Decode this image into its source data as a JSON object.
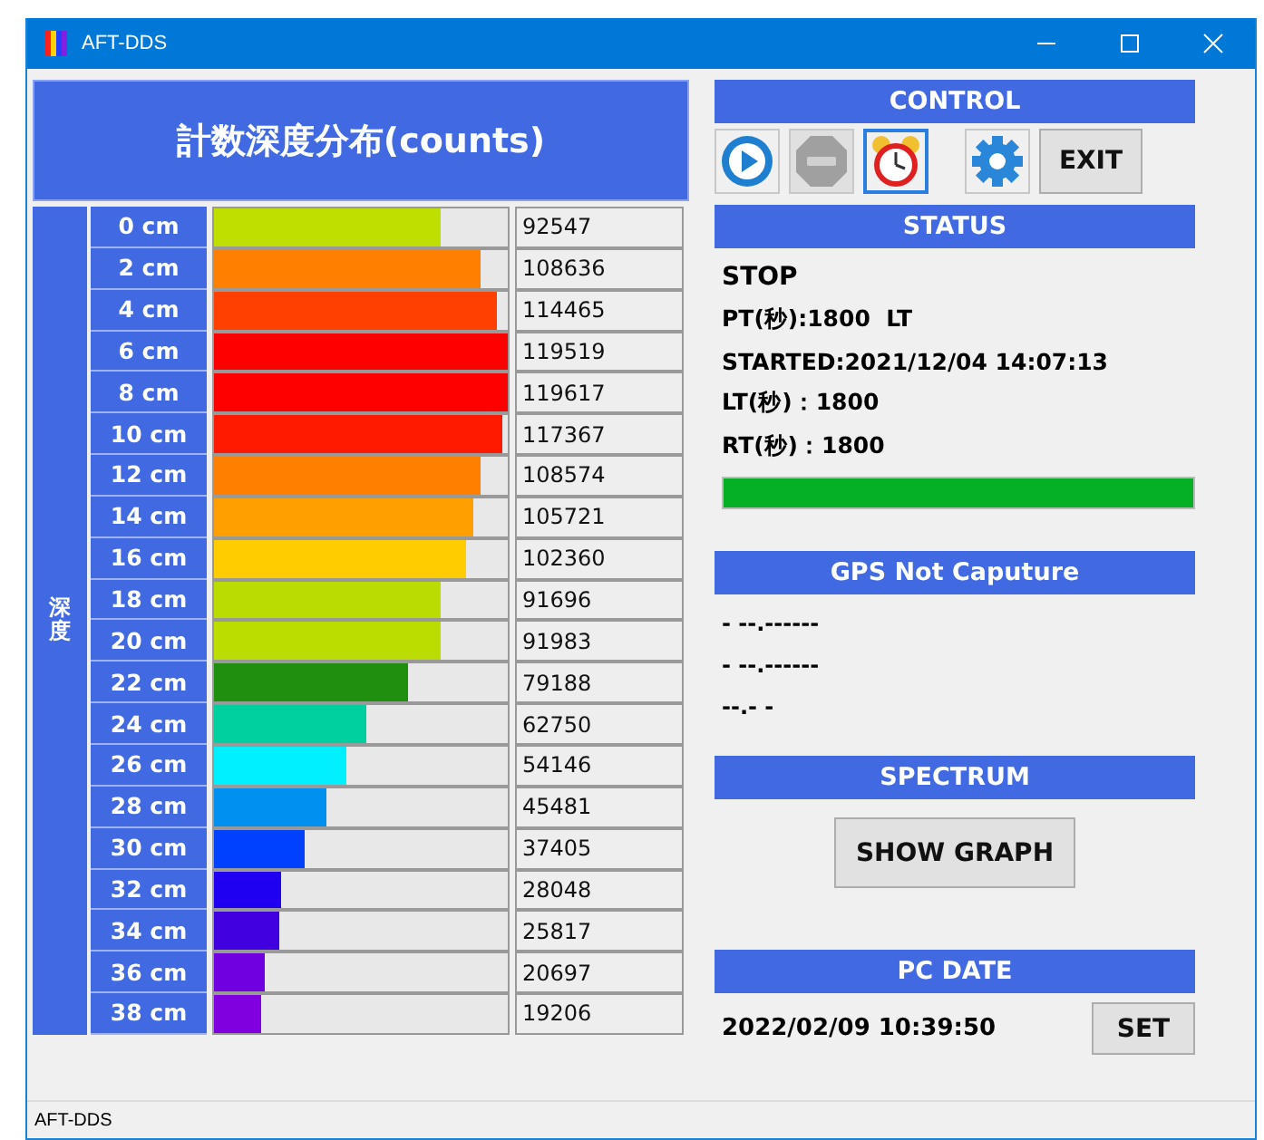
{
  "window": {
    "title": "AFT-DDS"
  },
  "chart_panel": {
    "title": "計数深度分布(counts)",
    "axis_label": "深度",
    "rows": [
      {
        "depth": "0 cm",
        "level": 0.77,
        "color": "#bfdf00",
        "count": "92547"
      },
      {
        "depth": "2 cm",
        "level": 0.91,
        "color": "#ff8000",
        "count": "108636"
      },
      {
        "depth": "4 cm",
        "level": 0.96,
        "color": "#ff4000",
        "count": "114465"
      },
      {
        "depth": "6 cm",
        "level": 1.0,
        "color": "#ff0000",
        "count": "119519"
      },
      {
        "depth": "8 cm",
        "level": 1.0,
        "color": "#ff0000",
        "count": "119617"
      },
      {
        "depth": "10 cm",
        "level": 0.98,
        "color": "#ff1a00",
        "count": "117367"
      },
      {
        "depth": "12 cm",
        "level": 0.91,
        "color": "#ff7f00",
        "count": "108574"
      },
      {
        "depth": "14 cm",
        "level": 0.88,
        "color": "#ffa000",
        "count": "105721"
      },
      {
        "depth": "16 cm",
        "level": 0.86,
        "color": "#ffcc00",
        "count": "102360"
      },
      {
        "depth": "18 cm",
        "level": 0.77,
        "color": "#bbdc00",
        "count": "91696"
      },
      {
        "depth": "20 cm",
        "level": 0.77,
        "color": "#bbdd00",
        "count": "91983"
      },
      {
        "depth": "22 cm",
        "level": 0.66,
        "color": "#208f10",
        "count": "79188"
      },
      {
        "depth": "24 cm",
        "level": 0.52,
        "color": "#00d0a0",
        "count": "62750"
      },
      {
        "depth": "26 cm",
        "level": 0.45,
        "color": "#00f0ff",
        "count": "54146"
      },
      {
        "depth": "28 cm",
        "level": 0.38,
        "color": "#0090f0",
        "count": "45481"
      },
      {
        "depth": "30 cm",
        "level": 0.31,
        "color": "#0040ff",
        "count": "37405"
      },
      {
        "depth": "32 cm",
        "level": 0.23,
        "color": "#2000f0",
        "count": "28048"
      },
      {
        "depth": "34 cm",
        "level": 0.22,
        "color": "#4000e0",
        "count": "25817"
      },
      {
        "depth": "36 cm",
        "level": 0.17,
        "color": "#7000e0",
        "count": "20697"
      },
      {
        "depth": "38 cm",
        "level": 0.16,
        "color": "#8000e0",
        "count": "19206"
      }
    ]
  },
  "control": {
    "title": "CONTROL",
    "tools": [
      {
        "kind": "play",
        "disabled": false,
        "focused": false
      },
      {
        "kind": "stop",
        "disabled": true,
        "focused": false
      },
      {
        "kind": "alarm",
        "disabled": false,
        "focused": true
      },
      {
        "kind": "settings",
        "disabled": false,
        "focused": false
      }
    ],
    "exit_button": "EXIT"
  },
  "status": {
    "title": "STATUS",
    "state": "STOP",
    "lines": [
      "PT(秒):1800  LT",
      "STARTED:2021/12/04 14:07:13",
      "LT(秒)：1800",
      "RT(秒)：1800"
    ],
    "level": 1.0
  },
  "gps": {
    "title": "GPS Not Caputure",
    "lines": [
      "- --.------",
      "- --.------",
      "--.- -"
    ]
  },
  "spectrum": {
    "title": "SPECTRUM",
    "button": "SHOW GRAPH"
  },
  "pc_date": {
    "title": "PC DATE",
    "value": "2022/02/09 10:39:50",
    "button": "SET"
  },
  "status_bar": "AFT-DDS"
}
